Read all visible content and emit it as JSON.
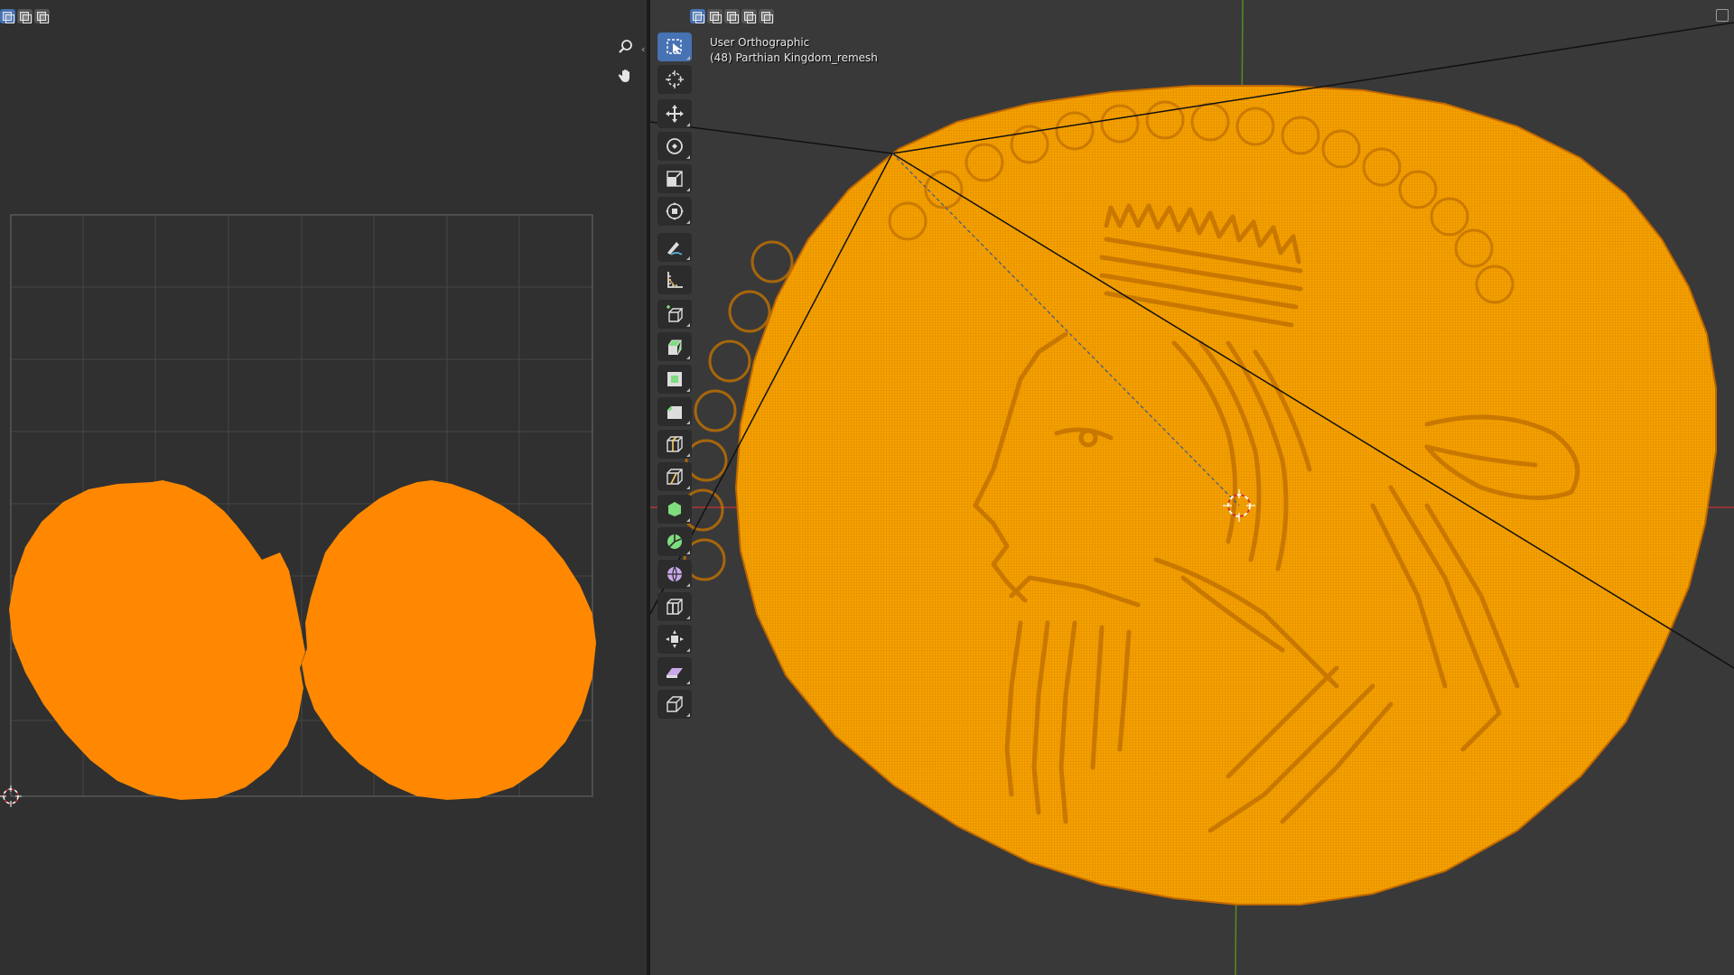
{
  "uv_editor": {
    "select_modes": [
      "vertex-select-icon",
      "edge-select-icon",
      "face-select-icon"
    ],
    "nav": [
      "zoom-icon",
      "pan-hand-icon"
    ],
    "colors": {
      "background": "#303030",
      "grid": "#4a4a4a",
      "uv_fill": "#ff8800"
    }
  },
  "viewport": {
    "view_name": "User Orthographic",
    "object_info": "(48) Parthian Kingdom_remesh",
    "select_modes": [
      "select-new-icon",
      "select-extend-icon",
      "select-subtract-icon",
      "select-invert-icon",
      "select-intersect-icon"
    ],
    "tools": [
      "select-box-icon",
      "cursor-icon",
      "move-icon",
      "rotate-icon",
      "scale-icon",
      "transform-icon",
      "annotate-icon",
      "measure-icon",
      "add-cube-icon",
      "extrude-icon",
      "inset-icon",
      "bevel-icon",
      "loop-cut-icon",
      "knife-icon",
      "poly-build-icon",
      "spin-icon",
      "smooth-icon",
      "edge-slide-icon",
      "shrink-fatten-icon",
      "shear-icon",
      "rip-icon"
    ],
    "colors": {
      "background": "#393939",
      "mesh": "#f5a000",
      "wire": "#c97a00",
      "axis_x": "#d04040",
      "axis_z": "#6a9a2a"
    }
  }
}
